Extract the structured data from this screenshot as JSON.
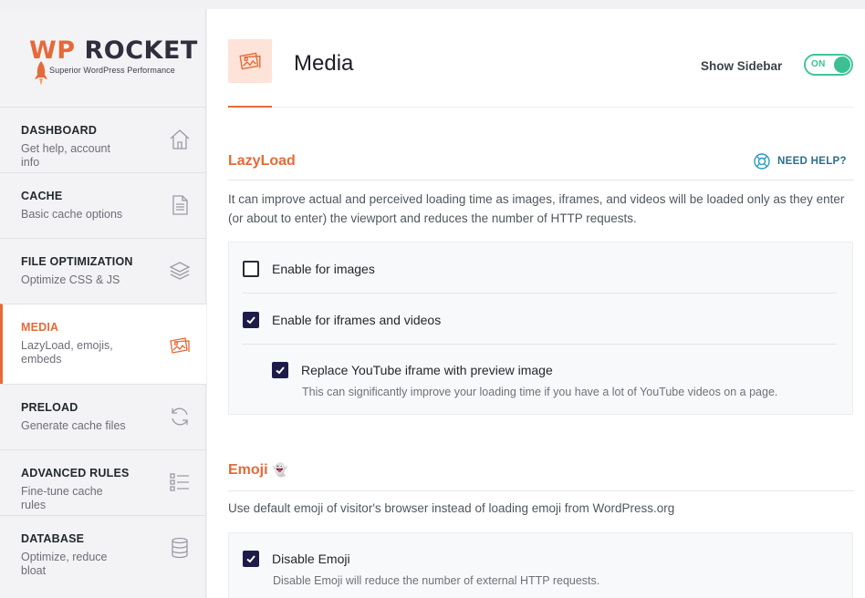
{
  "brand": {
    "wp": "WP",
    "rocket": " ROCKET",
    "tagline": "Superior WordPress Performance",
    "accent": "#e66a38"
  },
  "sidebar": {
    "items": [
      {
        "title": "DASHBOARD",
        "subtitle": "Get help, account info",
        "icon": "home-icon"
      },
      {
        "title": "CACHE",
        "subtitle": "Basic cache options",
        "icon": "document-icon"
      },
      {
        "title": "FILE OPTIMIZATION",
        "subtitle": "Optimize CSS & JS",
        "icon": "layers-icon"
      },
      {
        "title": "MEDIA",
        "subtitle": "LazyLoad, emojis, embeds",
        "icon": "images-icon",
        "active": true
      },
      {
        "title": "PRELOAD",
        "subtitle": "Generate cache files",
        "icon": "refresh-icon"
      },
      {
        "title": "ADVANCED RULES",
        "subtitle": "Fine-tune cache rules",
        "icon": "list-icon"
      },
      {
        "title": "DATABASE",
        "subtitle": "Optimize, reduce bloat",
        "icon": "database-icon"
      }
    ]
  },
  "header": {
    "title": "Media",
    "show_sidebar_label": "Show Sidebar",
    "toggle_label": "ON",
    "toggle_on": true
  },
  "lazyload": {
    "title": "LazyLoad",
    "help_label": "NEED HELP?",
    "description": "It can improve actual and perceived loading time as images, iframes, and videos will be loaded only as they enter (or about to enter) the viewport and reduces the number of HTTP requests.",
    "options": {
      "images": {
        "label": "Enable for images",
        "checked": false
      },
      "iframes": {
        "label": "Enable for iframes and videos",
        "checked": true
      },
      "youtube": {
        "label": "Replace YouTube iframe with preview image",
        "checked": true,
        "description": "This can significantly improve your loading time if you have a lot of YouTube videos on a page."
      }
    }
  },
  "emoji": {
    "title": "Emoji",
    "title_emoji": "👻",
    "description": "Use default emoji of visitor's browser instead of loading emoji from WordPress.org",
    "options": {
      "disable": {
        "label": "Disable Emoji",
        "checked": true,
        "description": "Disable Emoji will reduce the number of external HTTP requests."
      }
    }
  }
}
